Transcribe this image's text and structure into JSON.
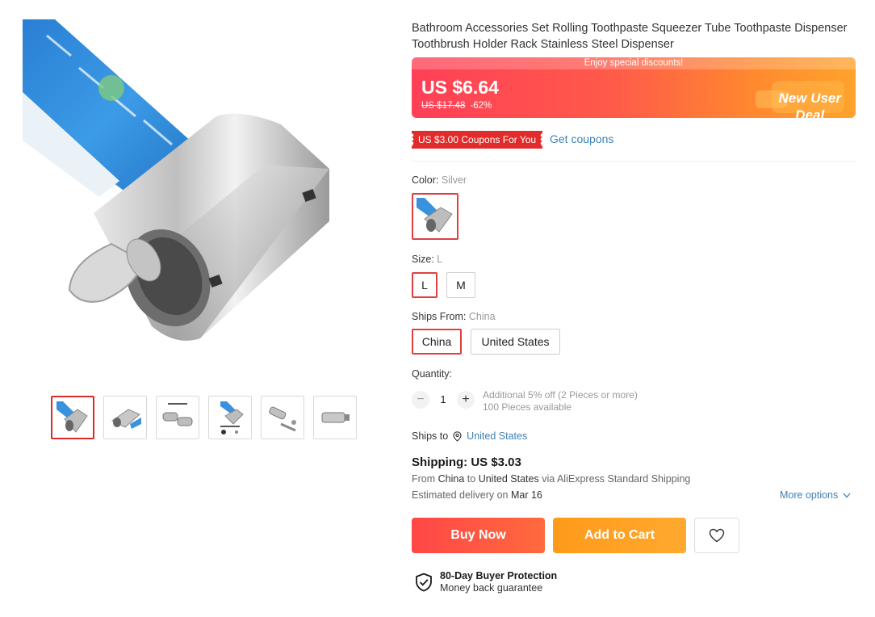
{
  "product": {
    "title": "Bathroom Accessories Set Rolling Toothpaste Squeezer Tube Toothpaste Dispenser Toothbrush Holder Rack Stainless Steel Dispenser"
  },
  "gallery": {
    "thumbnails": [
      "thumb-1",
      "thumb-2",
      "thumb-3",
      "thumb-4",
      "thumb-5",
      "thumb-6"
    ],
    "active_index": 0
  },
  "price": {
    "banner_text": "Enjoy special discounts!",
    "current": "US $6.64",
    "original": "US $17.48",
    "discount": "-62%",
    "deal_line1": "New User",
    "deal_line2": "Deal"
  },
  "coupon": {
    "tag": "US $3.00 Coupons For You",
    "link": "Get coupons"
  },
  "color": {
    "label": "Color: ",
    "value": "Silver"
  },
  "size": {
    "label": "Size: ",
    "value": "L",
    "options": [
      "L",
      "M"
    ]
  },
  "ships_from": {
    "label": "Ships From: ",
    "value": "China",
    "options": [
      "China",
      "United States"
    ]
  },
  "quantity": {
    "label": "Quantity:",
    "minus": "−",
    "value": "1",
    "plus": "+",
    "info_line1": "Additional 5% off (2 Pieces or more)",
    "info_line2": "100 Pieces available"
  },
  "shipping": {
    "ships_to_label": "Ships to",
    "ships_to_country": "United States",
    "cost": "Shipping: US $3.03",
    "from_prefix": "From ",
    "from_country": "China",
    "to_word": " to ",
    "to_country": "United States",
    "via_text": " via AliExpress Standard Shipping",
    "delivery_prefix": "Estimated delivery on ",
    "delivery_date": "Mar 16",
    "more_options": "More options"
  },
  "actions": {
    "buy_now": "Buy Now",
    "add_to_cart": "Add to Cart"
  },
  "protection": {
    "title": "80-Day Buyer Protection",
    "subtitle": "Money back guarantee"
  },
  "colors": {
    "accent_red": "#e13f3f",
    "link_blue": "#3e82b4",
    "buy_now": "#ff4747",
    "add_to_cart": "#ffa11f"
  }
}
